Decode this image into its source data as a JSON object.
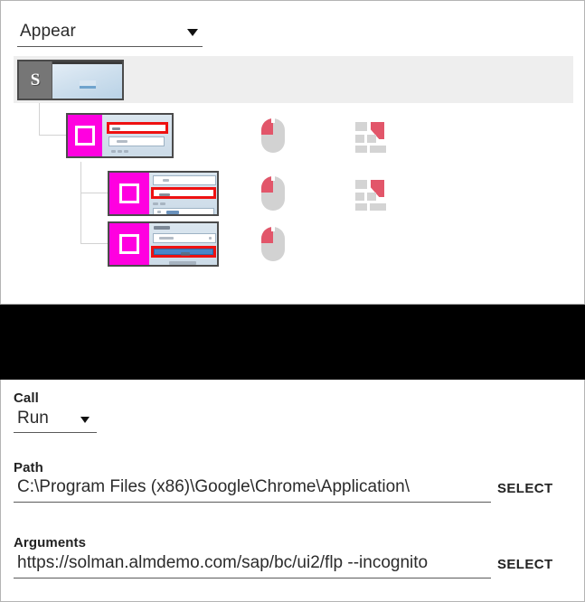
{
  "top_panel": {
    "mode_select": {
      "value": "Appear",
      "caret_icon": "chevron-down-icon"
    },
    "tree": {
      "root": {
        "badge": "S",
        "type": "start-node"
      },
      "steps": [
        {
          "index": 1,
          "action_icon": "mouse-left-click-icon",
          "target_icon": "tile-grid-icon",
          "highlight_color": "#ee1111",
          "accent_color": "#ff00e0"
        },
        {
          "index": 2,
          "action_icon": "mouse-left-click-icon",
          "target_icon": "tile-grid-icon",
          "highlight_color": "#ee1111",
          "accent_color": "#ff00e0"
        },
        {
          "index": 3,
          "action_icon": "mouse-left-click-icon",
          "target_icon": null,
          "highlight_color": "#ee1111",
          "accent_color": "#ff00e0"
        }
      ]
    }
  },
  "form": {
    "call": {
      "label": "Call",
      "value": "Run",
      "caret_icon": "chevron-down-icon"
    },
    "path": {
      "label": "Path",
      "value": "C:\\Program Files (x86)\\Google\\Chrome\\Application\\",
      "button": "SELECT"
    },
    "arguments": {
      "label": "Arguments",
      "value": "https://solman.almdemo.com/sap/bc/ui2/flp --incognito",
      "button": "SELECT"
    }
  }
}
